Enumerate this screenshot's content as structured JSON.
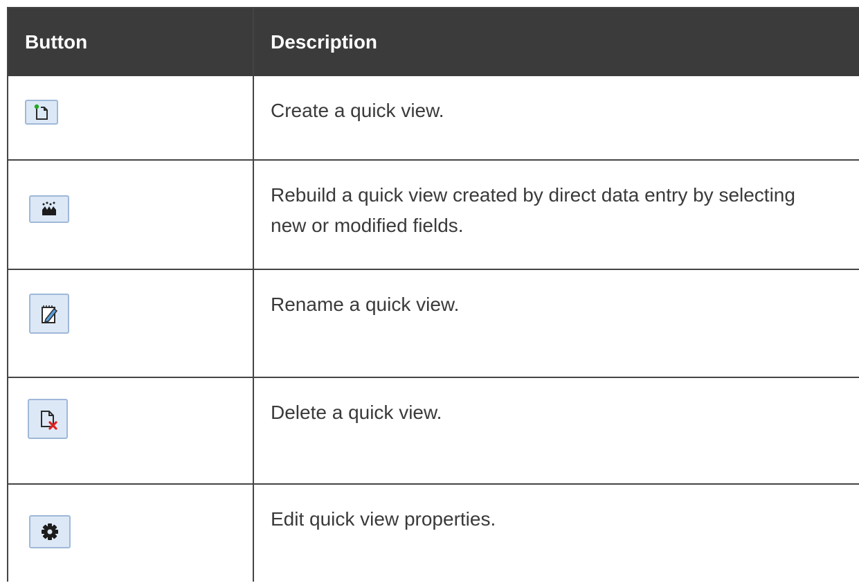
{
  "table": {
    "headers": {
      "button": "Button",
      "description": "Description"
    },
    "rows": [
      {
        "icon": "new-document-icon",
        "description": "Create a quick view."
      },
      {
        "icon": "rebuild-icon",
        "description": "Rebuild a quick view created by direct data entry by selecting new or modified fields."
      },
      {
        "icon": "rename-icon",
        "description": "Rename a quick view."
      },
      {
        "icon": "delete-document-icon",
        "description": "Delete a quick view."
      },
      {
        "icon": "gear-icon",
        "description": "Edit quick view properties."
      }
    ]
  },
  "colors": {
    "header_background": "#3b3b3b",
    "header_text": "#ffffff",
    "rule": "#444444",
    "button_fill": "#dde8f6",
    "button_border": "#9eb8d8"
  }
}
